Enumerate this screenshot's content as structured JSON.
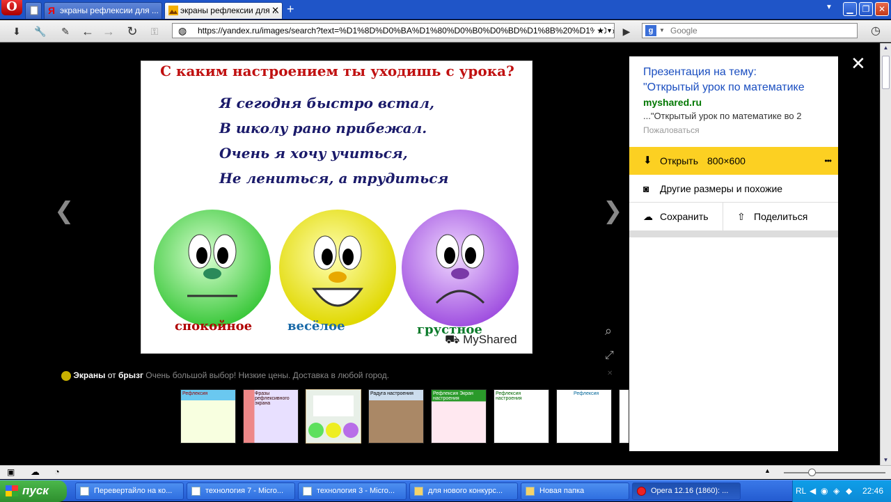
{
  "browser": {
    "opera_label": "O",
    "tabs": [
      {
        "label": ""
      },
      {
        "label": "экраны рефлексии для ..."
      },
      {
        "label": "экраны рефлексии для ..."
      }
    ],
    "new_tab": "+",
    "url": "https://yandex.ru/images/search?text=%D1%8D%D0%BA%D1%80%D0%B0%D0%BD%D1%8B%20%D1%80%D0%",
    "search_placeholder": "Google"
  },
  "slide": {
    "title": "С каким настроением ты уходишь с  урока?",
    "lines": [
      "Я сегодня быстро встал,",
      "В школу рано прибежал.",
      "Очень я хочу учиться,",
      "Не лениться, а трудиться"
    ],
    "faces": [
      {
        "label": "спокойное",
        "color": "#5ee05e",
        "label_color": "#b00000"
      },
      {
        "label": "весёлое",
        "color": "#eeee22",
        "label_color": "#1a6aa8"
      },
      {
        "label": "грустное",
        "color": "#b86ee8",
        "label_color": "#0a7a2a"
      }
    ],
    "watermark": "MyShared"
  },
  "ad": {
    "brand": "Экраны",
    "from": "от",
    "company": "брызг",
    "text": "Очень большой выбор! Низкие цены. Доставка в любой город."
  },
  "panel": {
    "title_line1": "Презентация на тему:",
    "title_line2": "\"Открытый урок по математике",
    "site": "myshared.ru",
    "snippet": "...\"Открытый урок по математике во 2",
    "complain": "Пожаловаться",
    "open_label": "Открыть",
    "open_size": "800×600",
    "more": "•••",
    "other_sizes": "Другие размеры и похожие",
    "save": "Сохранить",
    "share": "Поделиться"
  },
  "thumbs": [
    {
      "title": "Рефлексия"
    },
    {
      "title": "Фразы рефлексивного экрана"
    },
    {
      "title": ""
    },
    {
      "title": "Радуга настроения"
    },
    {
      "title": "Рефлексия Экран настроения"
    },
    {
      "title": "Рефлексия настроения"
    },
    {
      "title": "Рефлексия"
    },
    {
      "title": ""
    }
  ],
  "taskbar": {
    "start": "пуск",
    "tasks": [
      {
        "label": "Перевертайло на ко..."
      },
      {
        "label": "технология 7 - Micro..."
      },
      {
        "label": "технология 3 - Micro..."
      },
      {
        "label": "для нового конкурс..."
      },
      {
        "label": "Новая папка"
      },
      {
        "label": "Opera 12.16 (1860): ..."
      }
    ],
    "lang": "RL",
    "time": "22:46"
  }
}
